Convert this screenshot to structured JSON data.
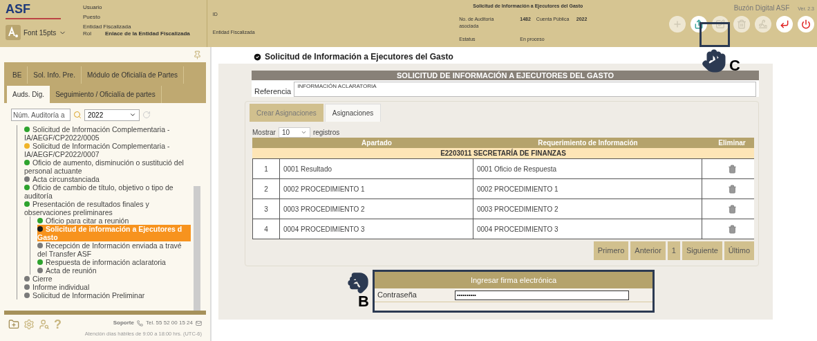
{
  "header": {
    "logo": "ASF",
    "user_labels": [
      "Usuario",
      "Puesto",
      "Entidad Fiscalizada"
    ],
    "rol_label": "Rol",
    "rol_value": "Enlace de la Entidad Fiscalizada",
    "font_size": "Font 15pts",
    "id_label": "ID",
    "entity_label": "Entidad Fiscalizada",
    "title": "Solicitud de Información a Ejecutores del Gasto",
    "audit_label": "No. de Auditoría asociada",
    "audit_value": "1482",
    "account_label": "Cuenta Pública",
    "account_value": "2022",
    "status_label": "Estatus",
    "status_value": "En proceso",
    "app_name": "Buzón Digital ASF",
    "version": "Ver. 2.3",
    "toolbar": [
      {
        "kind": "add",
        "disabled": true
      },
      {
        "kind": "forward",
        "disabled": false
      },
      {
        "kind": "edit",
        "disabled": true
      },
      {
        "kind": "delete",
        "disabled": true
      },
      {
        "kind": "sign",
        "disabled": true
      },
      {
        "kind": "back",
        "disabled": false
      },
      {
        "kind": "power",
        "disabled": false
      }
    ]
  },
  "sidebar": {
    "tabs_row_1": [
      {
        "label": "BE",
        "selected": false
      },
      {
        "label": "Sol. Info. Pre.",
        "selected": false
      },
      {
        "label": "Módulo de Oficialía de Partes",
        "selected": false
      }
    ],
    "tabs_row_2": [
      {
        "label": "Auds. Dig.",
        "selected": true
      },
      {
        "label": "Seguimiento / Oficialía de partes",
        "selected": false
      }
    ],
    "search_placeholder": "Núm. Auditoría a",
    "year": "2022",
    "tree": [
      {
        "label": "Solicitud de Información Complementaria - IA/AEGF/CP2022/0005",
        "color": "#2ea32e",
        "selected": false
      },
      {
        "label": "Solicitud de Información Complementaria - IA/AEGF/CP2022/0007",
        "color": "#f0b429",
        "selected": false
      },
      {
        "label": "Oficio de aumento, disminución o sustitució del personal actuante",
        "color": "#2ea32e",
        "selected": false
      },
      {
        "label": "Acta circunstanciada",
        "color": "#7a7a7a",
        "selected": false
      },
      {
        "label": "Oficio de cambio de título, objetivo o tipo de auditoría",
        "color": "#2ea32e",
        "selected": false
      },
      {
        "label": "Presentación de resultados finales y observaciones preliminares",
        "color": "#2ea32e",
        "selected": false,
        "children": [
          {
            "label": "Oficio para citar a reunión",
            "color": "#2ea32e",
            "selected": false
          },
          {
            "label": "Solicitud de información a Ejecutores d Gasto",
            "color": "#1a1a1a",
            "selected": true
          },
          {
            "label": "Recepción de Información enviada a travé del Transfer ASF",
            "color": "#7a7a7a",
            "selected": false
          },
          {
            "label": "Respuesta de información aclaratoria",
            "color": "#2ea32e",
            "selected": false
          },
          {
            "label": "Acta de reunión",
            "color": "#7a7a7a",
            "selected": false
          }
        ]
      },
      {
        "label": "Cierre",
        "color": "#7a7a7a",
        "selected": false
      },
      {
        "label": "Informe individual",
        "color": "#7a7a7a",
        "selected": false
      },
      {
        "label": "Solicitud de Información Preliminar",
        "color": "#7a7a7a",
        "selected": false
      }
    ],
    "help": "?",
    "support": "Soporte",
    "phone": "Tel. 55 52 00 15 24",
    "hours": "Atención días hábiles de 9:00 a 18:00 hrs. (UTC-6)"
  },
  "main": {
    "heading": "Solicitud de Información a Ejecutores del Gasto",
    "panel_title": "SOLICITUD DE INFORMACIÓN A EJECUTORES DEL GASTO",
    "reference_label": "Referencia",
    "reference_value": "INFORMACIÓN ACLARATORIA",
    "tabs": [
      {
        "label": "Crear Asignaciones",
        "selected": false
      },
      {
        "label": "Asignaciones",
        "selected": true
      }
    ],
    "show_label": "Mostrar",
    "show_value": "10",
    "records_label": "registros",
    "table": {
      "columns": [
        "Apartado",
        "Requerimiento de Información",
        "Eliminar"
      ],
      "group": "E2203011 SECRETARÍA DE FINANZAS",
      "rows": [
        [
          "1",
          "0001 Resultado",
          "0001 Oficio de Respuesta"
        ],
        [
          "2",
          "0002 PROCEDIMIENTO 1",
          "0002 PROCEDIMIENTO 1"
        ],
        [
          "3",
          "0003 PROCEDIMIENTO 2",
          "0003 PROCEDIMIENTO 2"
        ],
        [
          "4",
          "0004 PROCEDIMIENTO 3",
          "0004 PROCEDIMIENTO 3"
        ]
      ]
    },
    "pagination": [
      "Primero",
      "Anterior",
      "1",
      "Siguiente",
      "Último"
    ],
    "signature": {
      "title": "Ingresar firma electrónica",
      "label": "Contraseña",
      "value": "••••••••••"
    }
  },
  "annotations": [
    {
      "letter": "C"
    },
    {
      "letter": "B"
    }
  ]
}
